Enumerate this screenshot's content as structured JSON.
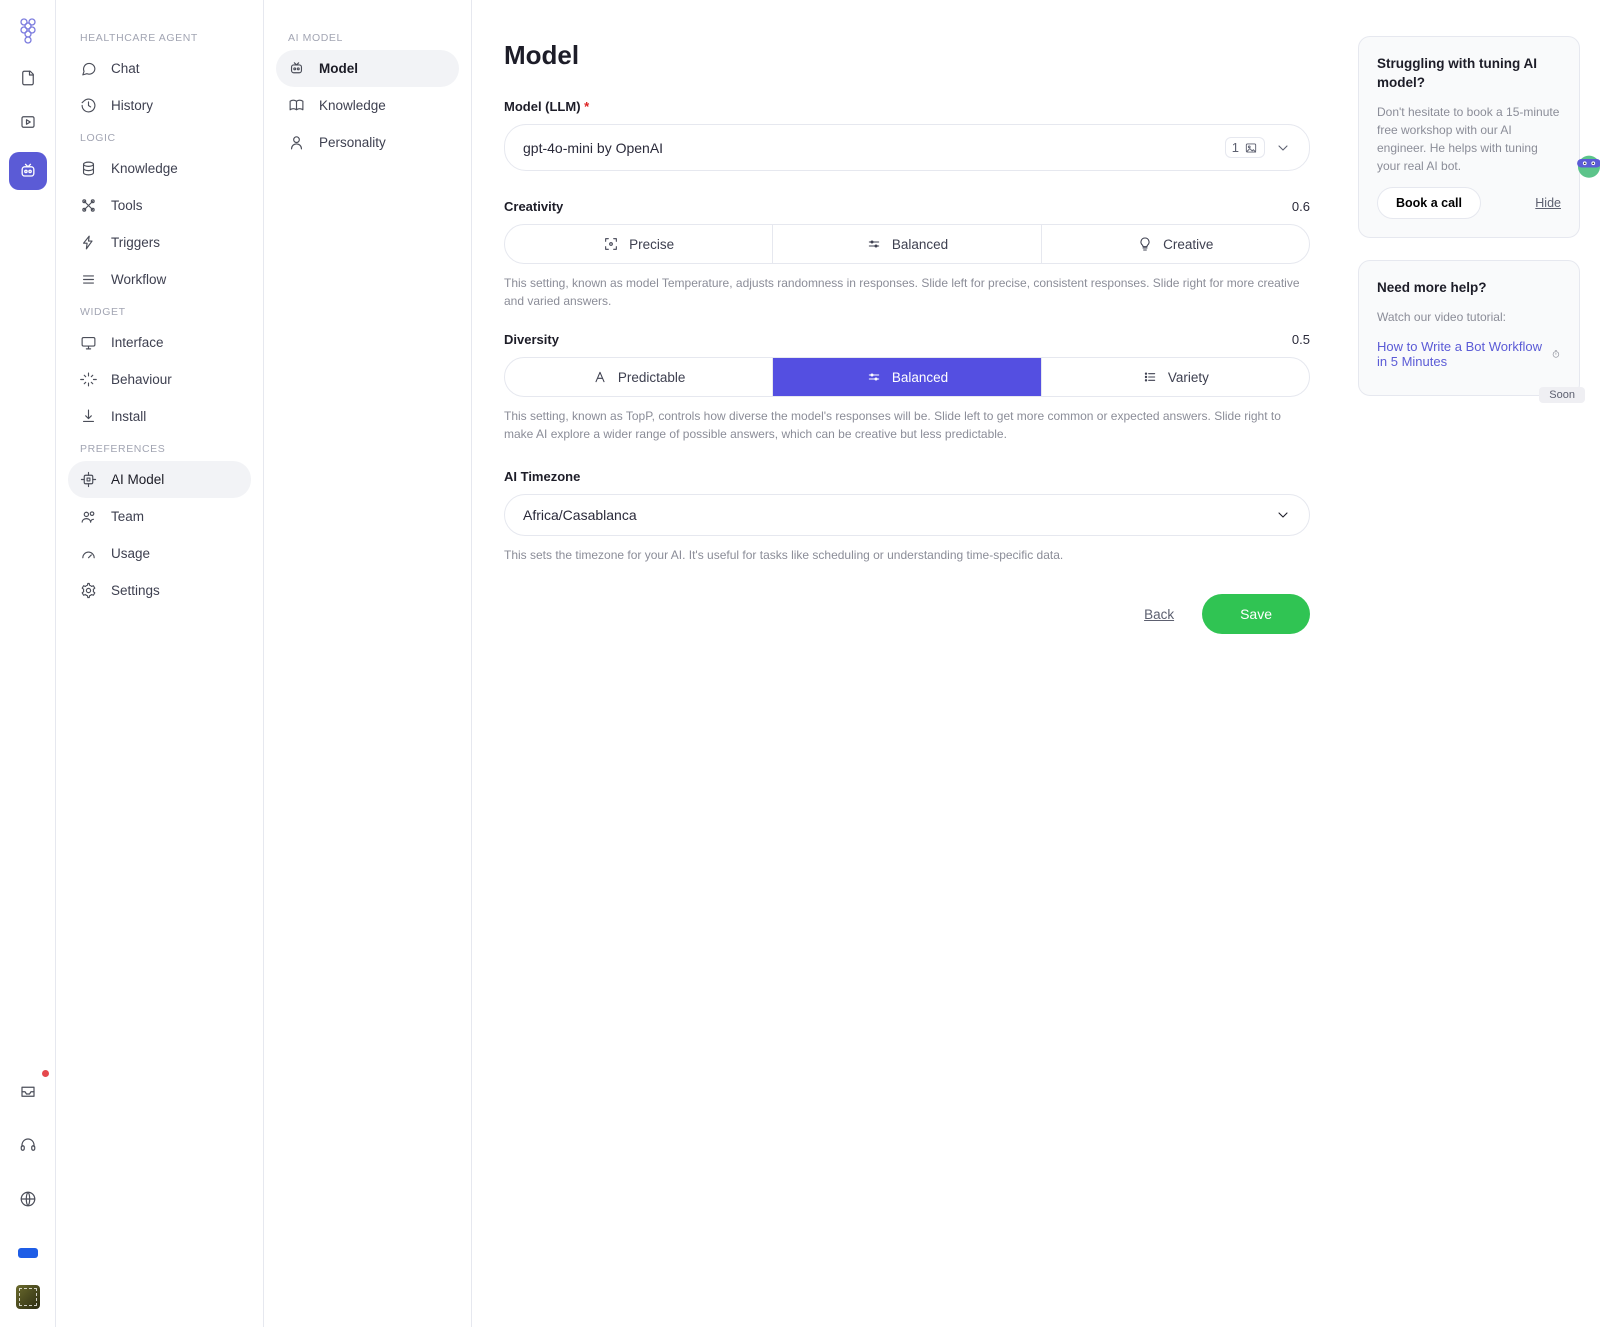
{
  "sidebar": {
    "group1_label": "HEALTHCARE AGENT",
    "group1": [
      {
        "label": "Chat"
      },
      {
        "label": "History"
      }
    ],
    "group2_label": "LOGIC",
    "group2": [
      {
        "label": "Knowledge"
      },
      {
        "label": "Tools"
      },
      {
        "label": "Triggers"
      },
      {
        "label": "Workflow"
      }
    ],
    "group3_label": "WIDGET",
    "group3": [
      {
        "label": "Interface"
      },
      {
        "label": "Behaviour"
      },
      {
        "label": "Install"
      }
    ],
    "group4_label": "PREFERENCES",
    "group4": [
      {
        "label": "AI Model"
      },
      {
        "label": "Team"
      },
      {
        "label": "Usage"
      },
      {
        "label": "Settings"
      }
    ]
  },
  "subsidebar": {
    "label": "AI MODEL",
    "items": [
      {
        "label": "Model"
      },
      {
        "label": "Knowledge"
      },
      {
        "label": "Personality"
      }
    ]
  },
  "main": {
    "title": "Model",
    "model_label": "Model (LLM)",
    "model_value": "gpt-4o-mini by OpenAI",
    "model_chip_count": "1",
    "creativity": {
      "label": "Creativity",
      "value": "0.6",
      "opts": [
        "Precise",
        "Balanced",
        "Creative"
      ],
      "help": "This setting, known as model Temperature, adjusts randomness in responses. Slide left for precise, consistent responses. Slide right for more creative and varied answers."
    },
    "diversity": {
      "label": "Diversity",
      "value": "0.5",
      "opts": [
        "Predictable",
        "Balanced",
        "Variety"
      ],
      "help": "This setting, known as TopP, controls how diverse the model's responses will be. Slide left to get more common or expected answers. Slide right to make AI explore a wider range of possible answers, which can be creative but less predictable."
    },
    "tz": {
      "label": "AI Timezone",
      "value": "Africa/Casablanca",
      "help": "This sets the timezone for your AI. It's useful for tasks like scheduling or understanding time-specific data."
    },
    "back": "Back",
    "save": "Save"
  },
  "cards": {
    "tune": {
      "title": "Struggling with tuning AI model?",
      "body": "Don't hesitate to book a 15-minute free workshop with our AI engineer. He helps with tuning your real AI bot.",
      "cta": "Book a call",
      "hide": "Hide"
    },
    "help": {
      "title": "Need more help?",
      "body": "Watch our video tutorial:",
      "link": "How to Write a Bot Workflow in 5 Minutes",
      "soon": "Soon"
    }
  }
}
